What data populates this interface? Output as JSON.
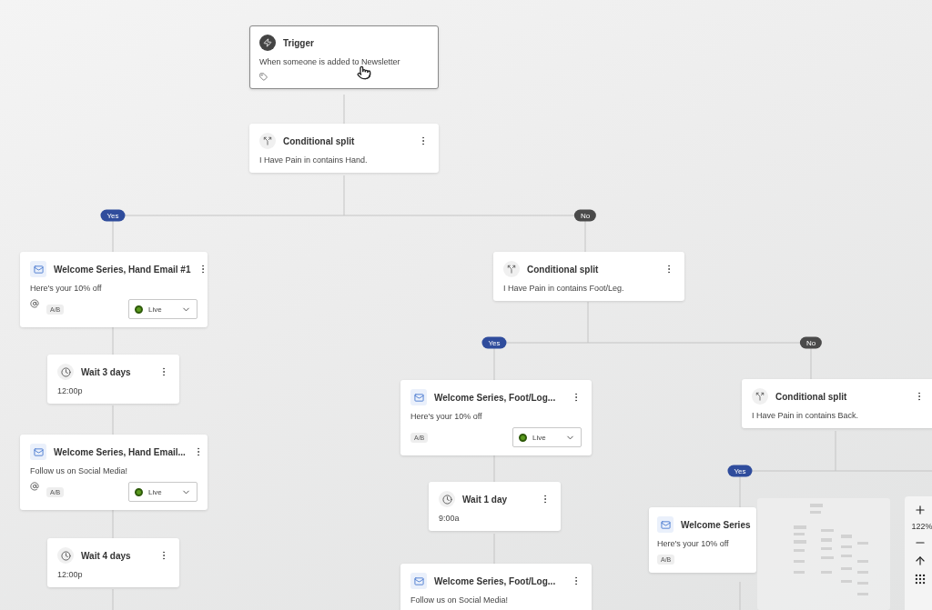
{
  "canvas": {
    "nodes": [
      {
        "kind": "trigger",
        "title": "Trigger",
        "description": "When someone is added to Newsletter"
      },
      {
        "kind": "split",
        "title": "Conditional split",
        "condition": "I Have Pain in contains Hand."
      },
      {
        "kind": "email",
        "title": "Welcome Series, Hand Email #1",
        "subtitle": "Here's your 10% off",
        "smart_sending": true,
        "ab": "A/B",
        "status": "Live"
      },
      {
        "kind": "wait",
        "title": "Wait 3 days",
        "time": "12:00p"
      },
      {
        "kind": "email",
        "title": "Welcome Series, Hand Email...",
        "subtitle": "Follow us on Social Media!",
        "smart_sending": true,
        "ab": "A/B",
        "status": "Live"
      },
      {
        "kind": "wait",
        "title": "Wait 4 days",
        "time": "12:00p"
      },
      {
        "kind": "split",
        "title": "Conditional split",
        "condition": "I Have Pain in contains Foot/Leg."
      },
      {
        "kind": "email",
        "title": "Welcome Series, Foot/Log...",
        "subtitle": "Here's your 10% off",
        "smart_sending": false,
        "ab": "A/B",
        "status": "Live"
      },
      {
        "kind": "wait",
        "title": "Wait 1 day",
        "time": "9:00a"
      },
      {
        "kind": "email",
        "title": "Welcome Series, Foot/Log...",
        "subtitle": "Follow us on Social Media!"
      },
      {
        "kind": "split",
        "title": "Conditional split",
        "condition": "I Have Pain in contains Back."
      },
      {
        "kind": "email",
        "title": "Welcome Series",
        "subtitle": "Here's your 10% off",
        "smart_sending": false,
        "ab": "A/B"
      }
    ],
    "branch_labels": [
      {
        "label": "Yes",
        "color": "#2f4c9c"
      },
      {
        "label": "No",
        "color": "#4a4a4a"
      },
      {
        "label": "Yes",
        "color": "#2f4c9c"
      },
      {
        "label": "No",
        "color": "#4a4a4a"
      },
      {
        "label": "Yes",
        "color": "#2f4c9c"
      }
    ]
  },
  "zoom_controls": {
    "reading": "122%"
  }
}
